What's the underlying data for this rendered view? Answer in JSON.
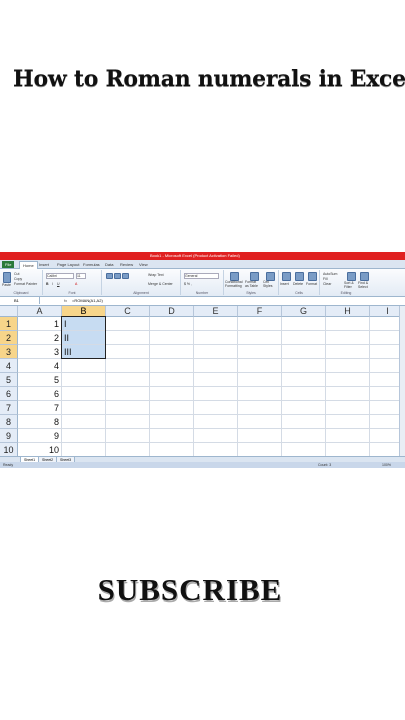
{
  "overlay": {
    "title": "How to Roman numerals in Excel",
    "subscribe": "SUBSCRIBE"
  },
  "excel": {
    "window_title": "Book1 - Microsoft Excel (Product Activation Failed)",
    "tabs": [
      "File",
      "Home",
      "Insert",
      "Page Layout",
      "Formulas",
      "Data",
      "Review",
      "View"
    ],
    "active_tab": "Home",
    "ribbon_groups": [
      "Clipboard",
      "Font",
      "Alignment",
      "Number",
      "Styles",
      "Cells",
      "Editing"
    ],
    "ribbon_items": {
      "cut": "Cut",
      "copy": "Copy",
      "format_painter": "Format Painter",
      "paste": "Paste",
      "font_name": "Calibri",
      "font_size": "11",
      "wrap_text": "Wrap Text",
      "merge_center": "Merge & Center",
      "number_format": "General",
      "conditional_formatting": "Conditional Formatting",
      "format_as_table": "Format as Table",
      "cell_styles": "Cell Styles",
      "insert": "Insert",
      "delete": "Delete",
      "format": "Format",
      "autosum": "AutoSum",
      "fill": "Fill",
      "clear": "Clear",
      "sort_filter": "Sort & Filter",
      "find_select": "Find & Select"
    },
    "name_box": "B1",
    "fx_label": "fx",
    "formula": "=ROMAN(A1,A2)",
    "columns": [
      "A",
      "B",
      "C",
      "D",
      "E",
      "F",
      "G",
      "H",
      "I"
    ],
    "selected_column": "B",
    "rows": [
      {
        "row": "1",
        "a": "1",
        "b": "I"
      },
      {
        "row": "2",
        "a": "2",
        "b": "II"
      },
      {
        "row": "3",
        "a": "3",
        "b": "III"
      },
      {
        "row": "4",
        "a": "4",
        "b": ""
      },
      {
        "row": "5",
        "a": "5",
        "b": ""
      },
      {
        "row": "6",
        "a": "6",
        "b": ""
      },
      {
        "row": "7",
        "a": "7",
        "b": ""
      },
      {
        "row": "8",
        "a": "8",
        "b": ""
      },
      {
        "row": "9",
        "a": "9",
        "b": ""
      },
      {
        "row": "10",
        "a": "10",
        "b": ""
      }
    ],
    "selected_rows": [
      "1",
      "2",
      "3"
    ],
    "sheets": [
      "Sheet1",
      "Sheet2",
      "Sheet3"
    ],
    "status": {
      "ready": "Ready",
      "count": "Count: 3",
      "zoom": "100%"
    }
  }
}
